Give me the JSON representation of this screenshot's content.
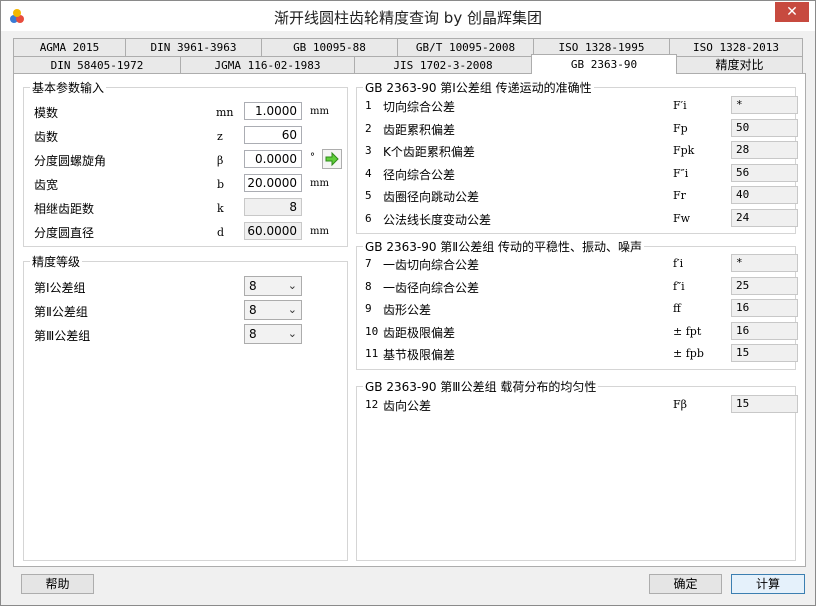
{
  "window": {
    "title": "渐开线圆柱齿轮精度查询 by 创晶辉集团",
    "close_label": "✕"
  },
  "tabs_row1": [
    "AGMA 2015",
    "DIN 3961-3963",
    "GB 10095-88",
    "GB/T 10095-2008",
    "ISO 1328-1995",
    "ISO 1328-2013"
  ],
  "tabs_row2": [
    "DIN 58405-1972",
    "JGMA 116-02-1983",
    "JIS 1702-3-2008",
    "GB 2363-90",
    "精度对比"
  ],
  "selected_tab": "GB 2363-90",
  "basic": {
    "title": "基本参数输入",
    "rows": [
      {
        "label": "模数",
        "symbol": "mn",
        "value": "1.0000",
        "unit": "mm"
      },
      {
        "label": "齿数",
        "symbol": "z",
        "value": "60",
        "unit": ""
      },
      {
        "label": "分度圆螺旋角",
        "symbol": "β",
        "value": "0.0000",
        "unit": "°"
      },
      {
        "label": "齿宽",
        "symbol": "b",
        "value": "20.0000",
        "unit": "mm"
      },
      {
        "label": "相继齿距数",
        "symbol": "k",
        "value": "8",
        "unit": ""
      },
      {
        "label": "分度圆直径",
        "symbol": "d",
        "value": "60.0000",
        "unit": "mm"
      }
    ]
  },
  "grade": {
    "title": "精度等级",
    "rows": [
      {
        "label": "第Ⅰ公差组",
        "value": "8"
      },
      {
        "label": "第Ⅱ公差组",
        "value": "8"
      },
      {
        "label": "第Ⅲ公差组",
        "value": "8"
      }
    ]
  },
  "groupI": {
    "title": "GB 2363-90 第Ⅰ公差组 传递运动的准确性",
    "rows": [
      {
        "n": "1",
        "name": "切向综合公差",
        "sym": "F′i",
        "value": "*"
      },
      {
        "n": "2",
        "name": "齿距累积偏差",
        "sym": "Fp",
        "value": "50"
      },
      {
        "n": "3",
        "name": "K个齿距累积偏差",
        "sym": "Fpk",
        "value": "28"
      },
      {
        "n": "4",
        "name": "径向综合公差",
        "sym": "F″i",
        "value": "56"
      },
      {
        "n": "5",
        "name": "齿圈径向跳动公差",
        "sym": "Fr",
        "value": "40"
      },
      {
        "n": "6",
        "name": "公法线长度变动公差",
        "sym": "Fw",
        "value": "24"
      }
    ]
  },
  "groupII": {
    "title": "GB 2363-90 第Ⅱ公差组 传动的平稳性、振动、噪声",
    "rows": [
      {
        "n": "7",
        "name": "一齿切向综合公差",
        "sym": "f′i",
        "value": "*"
      },
      {
        "n": "8",
        "name": "一齿径向综合公差",
        "sym": "f″i",
        "value": "25"
      },
      {
        "n": "9",
        "name": "齿形公差",
        "sym": "ff",
        "value": "16"
      },
      {
        "n": "10",
        "name": "齿距极限偏差",
        "sym": "± fpt",
        "value": "16"
      },
      {
        "n": "11",
        "name": "基节极限偏差",
        "sym": "± fpb",
        "value": "15"
      }
    ]
  },
  "groupIII": {
    "title": "GB 2363-90 第Ⅲ公差组 载荷分布的均匀性",
    "rows": [
      {
        "n": "12",
        "name": "齿向公差",
        "sym": "Fβ",
        "value": "15"
      }
    ]
  },
  "buttons": {
    "help": "帮助",
    "ok": "确定",
    "calc": "计算"
  }
}
